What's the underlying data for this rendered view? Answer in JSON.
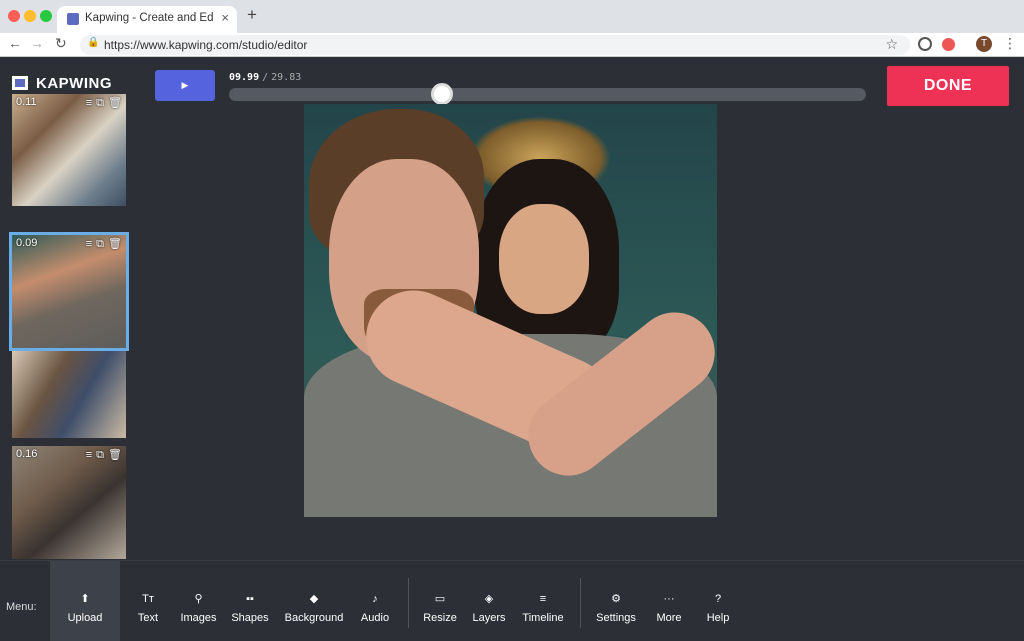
{
  "browser": {
    "tab_title": "Kapwing - Create and Edit Vid",
    "tab_close": "×",
    "new_tab": "+",
    "url": "https://www.kapwing.com/studio/editor",
    "profile_initial": "T"
  },
  "brand": {
    "name": "KAPWING"
  },
  "scenes": [
    {
      "time": "0.11",
      "selected": false
    },
    {
      "time": "0.09",
      "selected": true
    },
    {
      "time": "",
      "selected": false
    },
    {
      "time": "0.16",
      "selected": false
    }
  ],
  "player": {
    "play_icon": "▶",
    "current_time": "09.99",
    "separator": "/",
    "total_time": "29.83",
    "progress_fraction": 0.335
  },
  "done_label": "DONE",
  "menu": {
    "label": "Menu:",
    "items": [
      {
        "label": "Upload",
        "icon": "upload-icon",
        "glyph": "⬆",
        "active": true
      },
      {
        "label": "Text",
        "icon": "text-icon",
        "glyph": "Tт",
        "active": false
      },
      {
        "label": "Images",
        "icon": "search-icon",
        "glyph": "⚲",
        "active": false
      },
      {
        "label": "Shapes",
        "icon": "shapes-icon",
        "glyph": "▪▪",
        "active": false
      },
      {
        "label": "Background",
        "icon": "paint-bucket-icon",
        "glyph": "◆",
        "active": false
      },
      {
        "label": "Audio",
        "icon": "music-note-icon",
        "glyph": "♪",
        "active": false
      },
      {
        "label": "Resize",
        "icon": "resize-icon",
        "glyph": "▭",
        "active": false
      },
      {
        "label": "Layers",
        "icon": "layers-icon",
        "glyph": "◈",
        "active": false
      },
      {
        "label": "Timeline",
        "icon": "timeline-icon",
        "glyph": "≡",
        "active": false
      },
      {
        "label": "Settings",
        "icon": "gear-icon",
        "glyph": "⚙",
        "active": false
      },
      {
        "label": "More",
        "icon": "more-icon",
        "glyph": "···",
        "active": false
      },
      {
        "label": "Help",
        "icon": "help-icon",
        "glyph": "?",
        "active": false
      }
    ]
  },
  "colors": {
    "background": "#2c2f36",
    "play_button": "#5563de",
    "done_button": "#ee3255",
    "selection_outline": "#6aaee8"
  }
}
